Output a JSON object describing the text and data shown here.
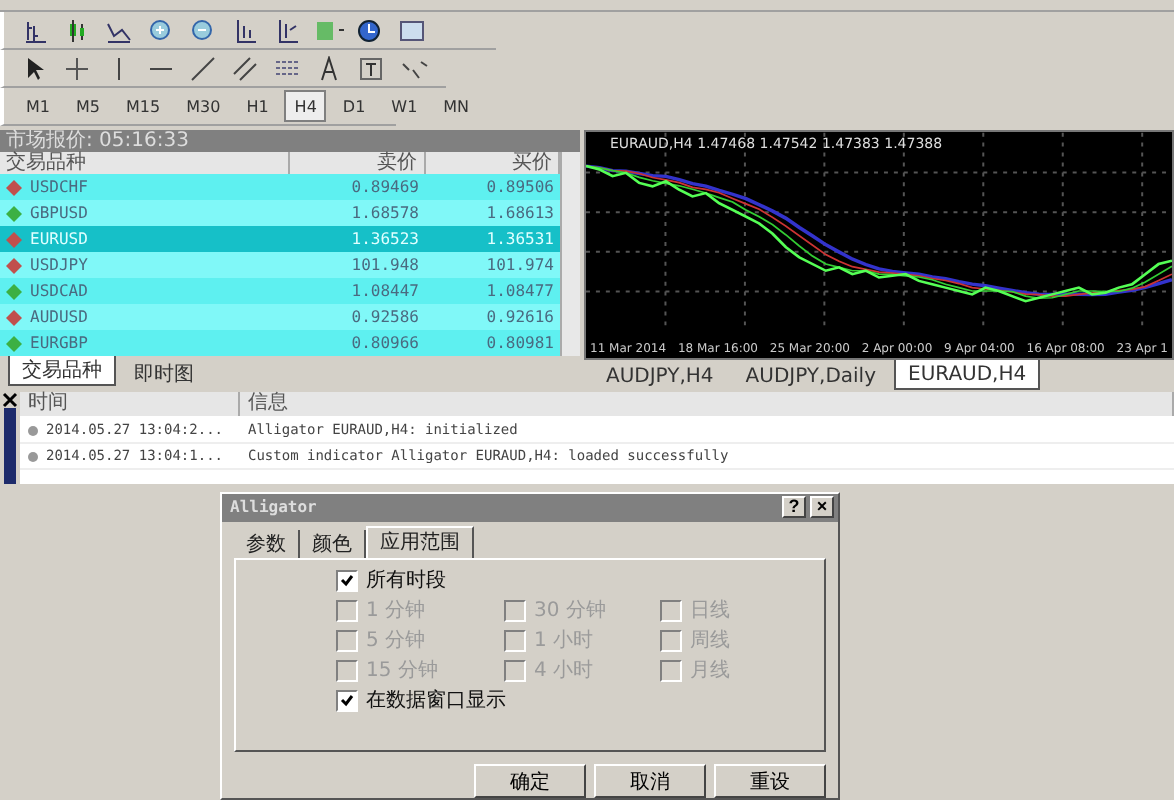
{
  "timeframes": [
    {
      "label": "M1",
      "selected": false
    },
    {
      "label": "M5",
      "selected": false
    },
    {
      "label": "M15",
      "selected": false
    },
    {
      "label": "M30",
      "selected": false
    },
    {
      "label": "H1",
      "selected": false
    },
    {
      "label": "H4",
      "selected": true
    },
    {
      "label": "D1",
      "selected": false
    },
    {
      "label": "W1",
      "selected": false
    },
    {
      "label": "MN",
      "selected": false
    }
  ],
  "market_watch": {
    "title": "市场报价: 05:16:33",
    "columns": [
      "交易品种",
      "卖价",
      "买价"
    ],
    "rows": [
      {
        "symbol": "USDCHF",
        "bid": "0.89469",
        "ask": "0.89506",
        "color": "#c0504d",
        "selected": false
      },
      {
        "symbol": "GBPUSD",
        "bid": "1.68578",
        "ask": "1.68613",
        "color": "#3cb043",
        "selected": false
      },
      {
        "symbol": "EURUSD",
        "bid": "1.36523",
        "ask": "1.36531",
        "color": "#c0504d",
        "selected": true
      },
      {
        "symbol": "USDJPY",
        "bid": "101.948",
        "ask": "101.974",
        "color": "#c0504d",
        "selected": false
      },
      {
        "symbol": "USDCAD",
        "bid": "1.08447",
        "ask": "1.08477",
        "color": "#3cb043",
        "selected": false
      },
      {
        "symbol": "AUDUSD",
        "bid": "0.92586",
        "ask": "0.92616",
        "color": "#c0504d",
        "selected": false
      },
      {
        "symbol": "EURGBP",
        "bid": "0.80966",
        "ask": "0.80981",
        "color": "#3cb043",
        "selected": false
      }
    ],
    "tabs": [
      {
        "label": "交易品种",
        "selected": true
      },
      {
        "label": "即时图",
        "selected": false
      }
    ]
  },
  "chart": {
    "title": "EURAUD,H4  1.47468 1.47542 1.47383 1.47388",
    "x_labels": [
      "11 Mar 2014",
      "18 Mar 16:00",
      "25 Mar 20:00",
      "2 Apr 00:00",
      "9 Apr 04:00",
      "16 Apr 08:00",
      "23 Apr 1"
    ],
    "tabs": [
      {
        "label": "AUDJPY,H4",
        "selected": false
      },
      {
        "label": "AUDJPY,Daily",
        "selected": false
      },
      {
        "label": "EURAUD,H4",
        "selected": true
      }
    ]
  },
  "log": {
    "columns": [
      "时间",
      "信息"
    ],
    "rows": [
      {
        "time": "2014.05.27 13:04:2...",
        "message": "Alligator EURAUD,H4: initialized"
      },
      {
        "time": "2014.05.27 13:04:1...",
        "message": "Custom indicator Alligator EURAUD,H4: loaded successfully"
      }
    ]
  },
  "dialog": {
    "title": "Alligator",
    "help": "?",
    "close": "×",
    "tabs": [
      {
        "label": "参数",
        "selected": false
      },
      {
        "label": "颜色",
        "selected": false
      },
      {
        "label": "应用范围",
        "selected": true
      }
    ],
    "all_periods": {
      "label": "所有时段",
      "checked": true,
      "disabled": false
    },
    "periods": [
      {
        "label": "1 分钟",
        "checked": false,
        "disabled": true
      },
      {
        "label": "30 分钟",
        "checked": false,
        "disabled": true
      },
      {
        "label": "日线",
        "checked": false,
        "disabled": true
      },
      {
        "label": "5 分钟",
        "checked": false,
        "disabled": true
      },
      {
        "label": "1 小时",
        "checked": false,
        "disabled": true
      },
      {
        "label": "周线",
        "checked": false,
        "disabled": true
      },
      {
        "label": "15 分钟",
        "checked": false,
        "disabled": true
      },
      {
        "label": "4 小时",
        "checked": false,
        "disabled": true
      },
      {
        "label": "月线",
        "checked": false,
        "disabled": true
      }
    ],
    "show_in_data_window": {
      "label": "在数据窗口显示",
      "checked": true,
      "disabled": false
    },
    "buttons": [
      "确定",
      "取消",
      "重设"
    ]
  }
}
